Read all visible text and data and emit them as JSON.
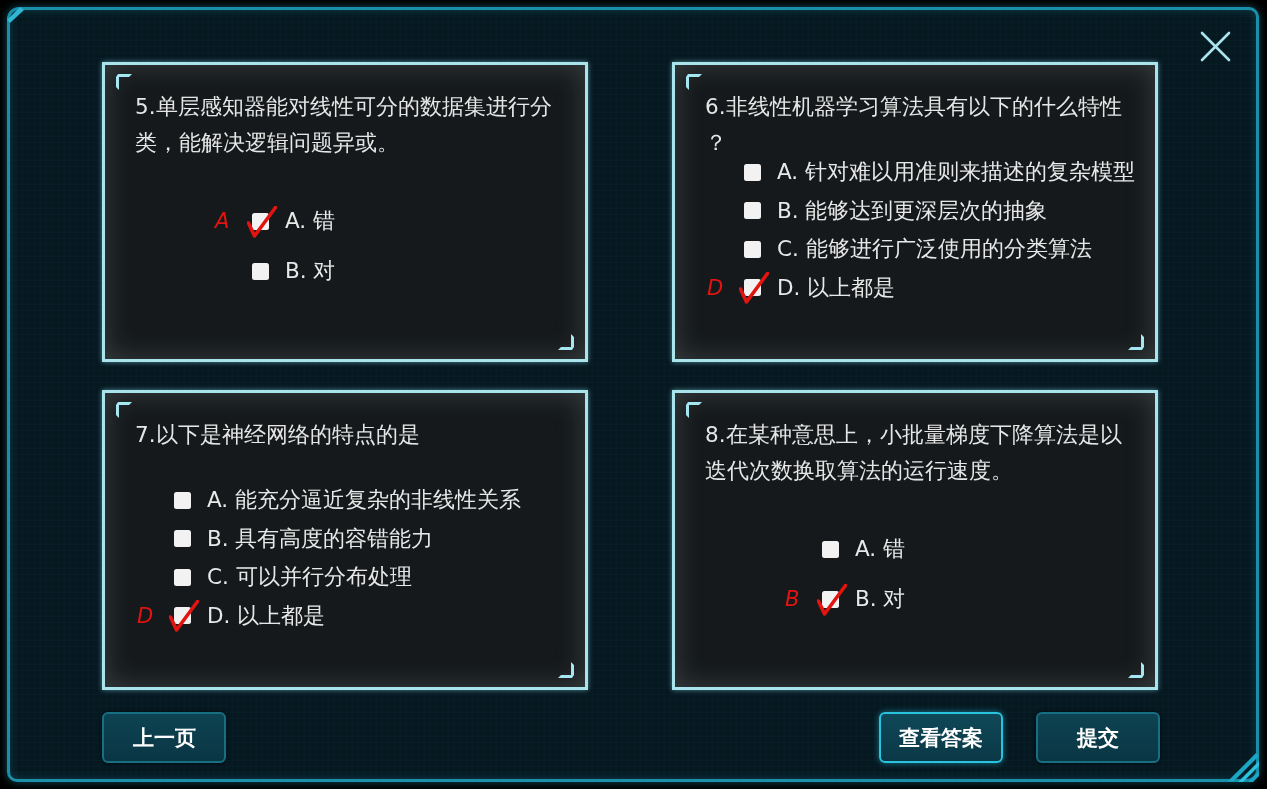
{
  "questions": [
    {
      "kind": "judge",
      "text": "5.单层感知器能对线性可分的数据集进行分类，能解决逻辑问题异或。",
      "options": [
        {
          "label": "A. 错",
          "checked": true,
          "mark": "A"
        },
        {
          "label": "B. 对",
          "checked": false
        }
      ]
    },
    {
      "kind": "choice",
      "text": "6.非线性机器学习算法具有以下的什么特性？",
      "options": [
        {
          "label": "A. 针对难以用准则来描述的复杂模型",
          "checked": false
        },
        {
          "label": "B. 能够达到更深层次的抽象",
          "checked": false
        },
        {
          "label": "C. 能够进行广泛使用的分类算法",
          "checked": false
        },
        {
          "label": "D. 以上都是",
          "checked": true,
          "mark": "D"
        }
      ]
    },
    {
      "kind": "choice",
      "text": "7.以下是神经网络的特点的是",
      "options": [
        {
          "label": "A. 能充分逼近复杂的非线性关系",
          "checked": false
        },
        {
          "label": "B. 具有高度的容错能力",
          "checked": false
        },
        {
          "label": "C. 可以并行分布处理",
          "checked": false
        },
        {
          "label": "D. 以上都是",
          "checked": true,
          "mark": "D"
        }
      ]
    },
    {
      "kind": "judge",
      "text": "8.在某种意思上，小批量梯度下降算法是以迭代次数换取算法的运行速度。",
      "options": [
        {
          "label": "A. 错",
          "checked": false
        },
        {
          "label": "B. 对",
          "checked": true,
          "mark": "B"
        }
      ]
    }
  ],
  "nav_button": {
    "label": "上一页",
    "focused": false
  },
  "action_buttons": [
    {
      "label": "查看答案",
      "focused": true
    },
    {
      "label": "提交",
      "focused": false
    }
  ]
}
